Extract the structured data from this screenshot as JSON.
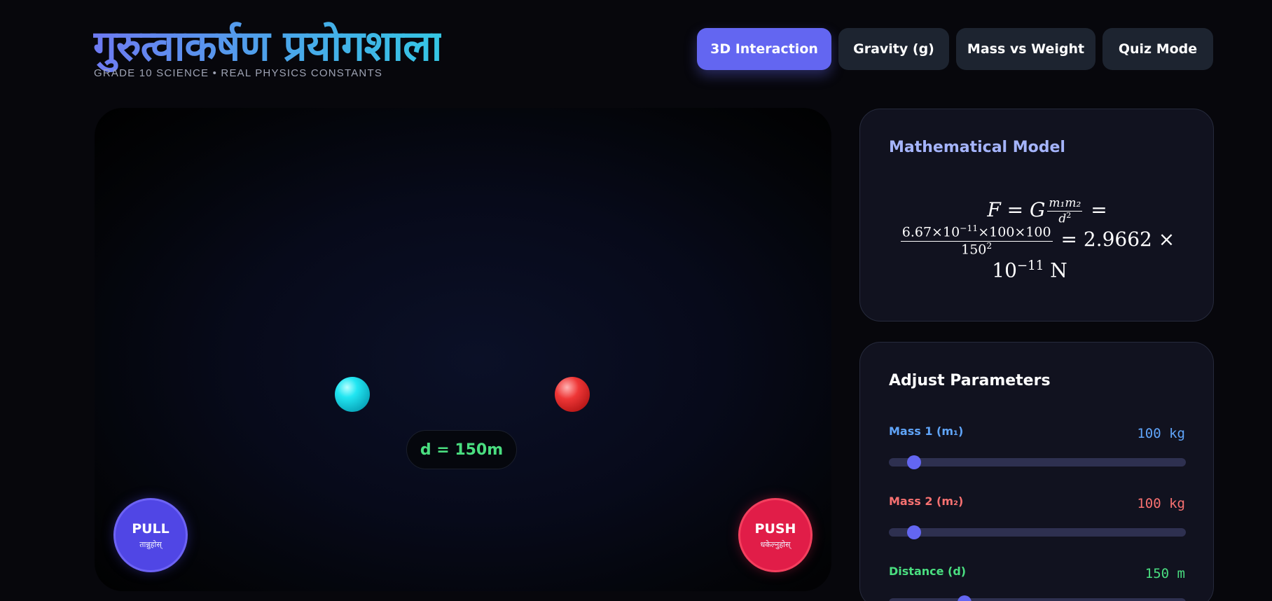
{
  "header": {
    "title": "गुरुत्वाकर्षण प्रयोगशाला",
    "subtitle": "GRADE 10 SCIENCE • REAL PHYSICS CONSTANTS"
  },
  "tabs": [
    {
      "label": "3D Interaction",
      "active": true
    },
    {
      "label": "Gravity (g)",
      "active": false
    },
    {
      "label": "Mass vs Weight",
      "active": false
    },
    {
      "label": "Quiz Mode",
      "active": false
    }
  ],
  "simulation": {
    "distance_label": "d = 150m",
    "pull": {
      "label": "PULL",
      "sublabel": "तान्नुहोस्"
    },
    "push": {
      "label": "PUSH",
      "sublabel": "धकेल्नुहोस्"
    }
  },
  "model": {
    "title": "Mathematical Model",
    "formula": {
      "lhs": "F",
      "constant": "G",
      "num_symbol": "m₁m₂",
      "den_symbol": "d",
      "den_exp": "2",
      "num_values": "6.67×10",
      "num_exp": "−11",
      "num_rest": "×100×100",
      "den_values": "150",
      "result": "2.9662",
      "result_base": "10",
      "result_exp": "−11",
      "unit": "N"
    }
  },
  "parameters": {
    "title": "Adjust Parameters",
    "items": [
      {
        "label": "Mass 1 (m₁)",
        "value": "100 kg",
        "fraction": 0.085,
        "color": "#60a5fa"
      },
      {
        "label": "Mass 2 (m₂)",
        "value": "100 kg",
        "fraction": 0.085,
        "color": "#f87171"
      },
      {
        "label": "Distance (d)",
        "value": "150 m",
        "fraction": 0.255,
        "color": "#4ade80"
      }
    ]
  },
  "colors": {
    "accent": "#6366f1",
    "mass1": "#22d3ee",
    "mass2": "#ef4444",
    "distance": "#4ade80",
    "pull": "#5046e5",
    "push": "#e11d48"
  }
}
